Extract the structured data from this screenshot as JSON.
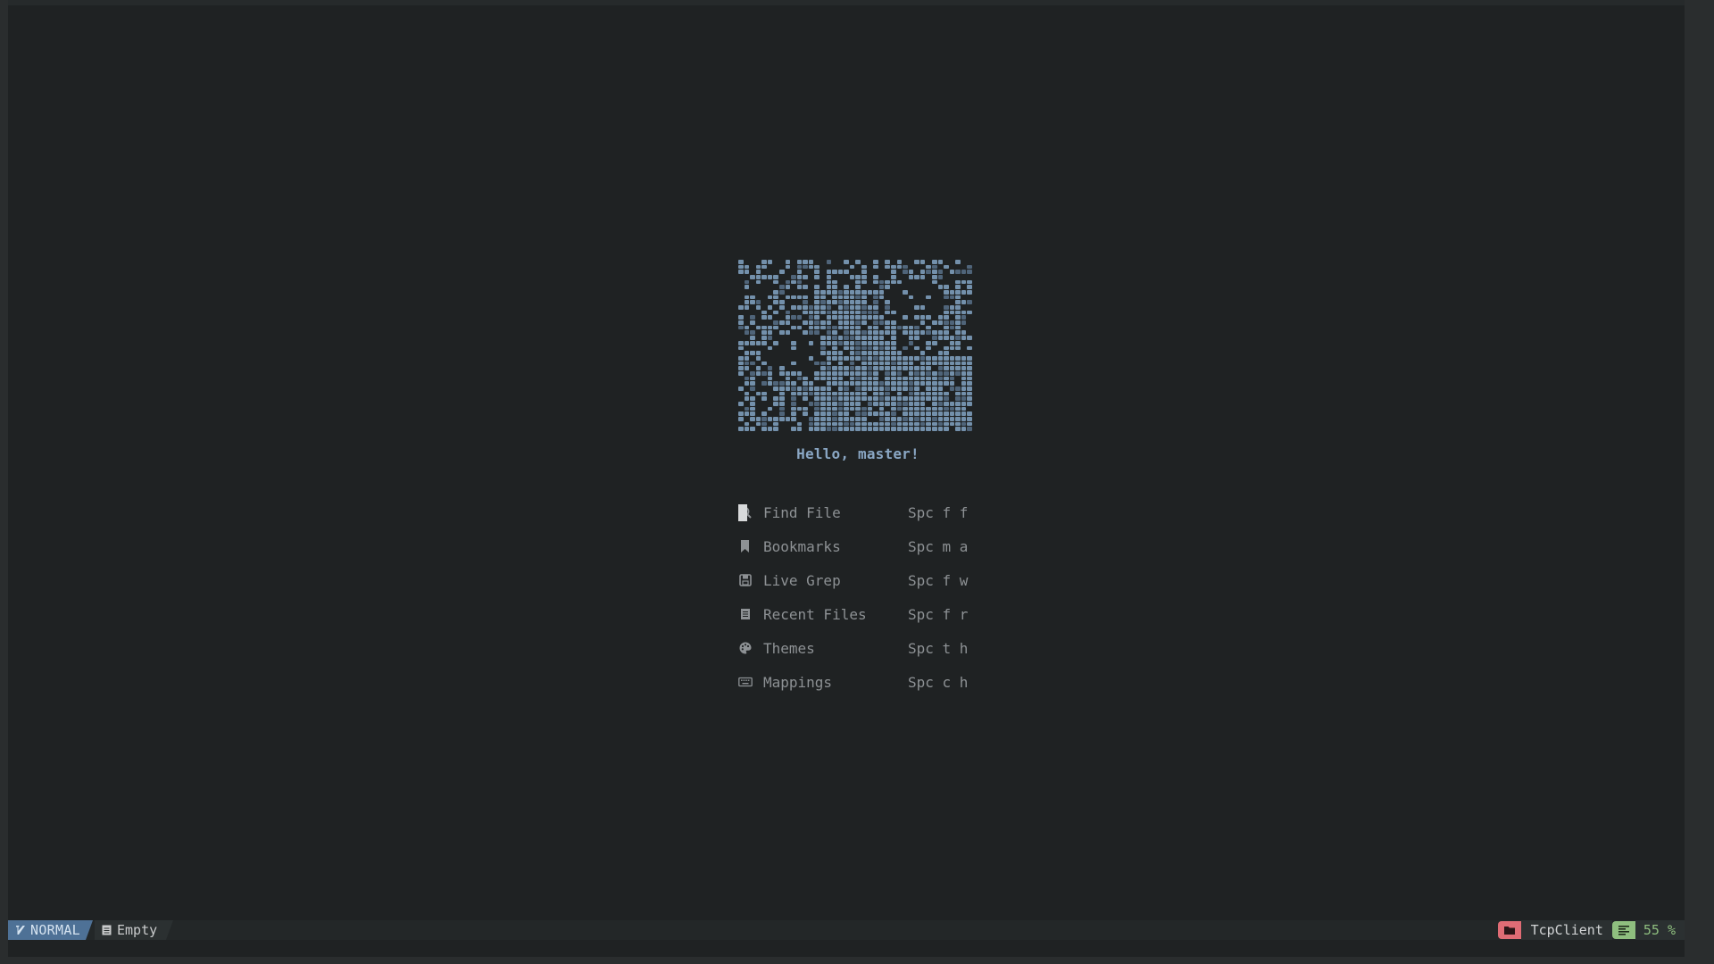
{
  "dashboard": {
    "greeting": "Hello, master!",
    "menu": [
      {
        "icon": "search-icon",
        "label": "Find File",
        "keys": "Spc f f"
      },
      {
        "icon": "bookmark-icon",
        "label": "Bookmarks",
        "keys": "Spc m a"
      },
      {
        "icon": "floppy-icon",
        "label": "Live Grep",
        "keys": "Spc f w"
      },
      {
        "icon": "document-icon",
        "label": "Recent Files",
        "keys": "Spc f r"
      },
      {
        "icon": "palette-icon",
        "label": "Themes",
        "keys": "Spc t h"
      },
      {
        "icon": "keyboard-icon",
        "label": "Mappings",
        "keys": "Spc c h"
      }
    ]
  },
  "statusline": {
    "mode": "NORMAL",
    "mode_icon": "vim-icon",
    "file": "Empty",
    "file_icon": "file-icon",
    "cwd": "TcpClient",
    "cwd_icon": "folder-icon",
    "position": "55 %",
    "position_icon": "lines-icon"
  },
  "colors": {
    "background": "#1f2223",
    "logo": "#7390ab",
    "greeting": "#8aa7c4",
    "menu_text": "#8d9194",
    "mode_bg": "#4e7196",
    "cwd_accent": "#e06c75",
    "position_accent": "#8fbf7f"
  }
}
